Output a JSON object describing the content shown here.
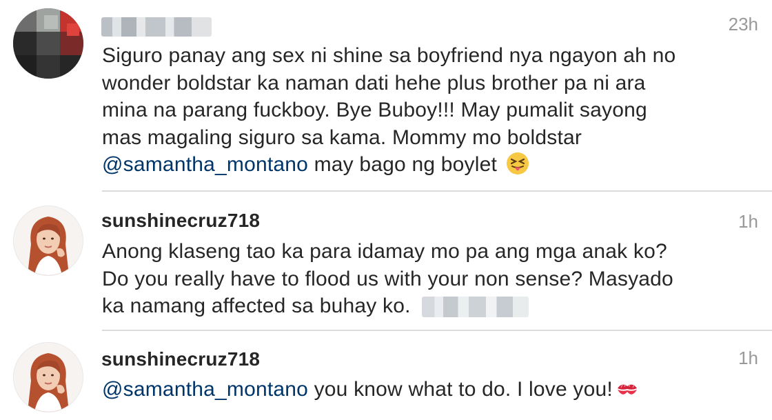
{
  "comments": [
    {
      "username": "",
      "timestamp": "23h",
      "lines": [
        "Siguro panay ang sex ni shine sa boyfriend nya ngayon ah no",
        "wonder boldstar ka naman dati hehe plus brother pa ni ara",
        "mina na parang fuckboy. Bye Buboy!!! May pumalit sayong",
        "mas magaling siguro sa kama. Mommy mo boldstar"
      ],
      "mention": "@samantha_montano",
      "after_mention": " may bago ng boylet",
      "emoji": "squinting-tongue-emoji"
    },
    {
      "username": "sunshinecruz718",
      "timestamp": "1h",
      "lines": [
        "Anong klaseng tao ka para idamay mo pa ang mga anak ko?",
        "Do you really have to flood us with your non sense? Masyado",
        "ka namang affected sa buhay ko."
      ]
    },
    {
      "username": "sunshinecruz718",
      "timestamp": "1h",
      "mention": "@samantha_montano",
      "after_mention": " you know what to do. I love you!",
      "emoji": "kiss-mark-emoji"
    }
  ],
  "colors": {
    "mention": "#003569",
    "timestamp": "#999999",
    "divider": "#dbdbdb"
  }
}
